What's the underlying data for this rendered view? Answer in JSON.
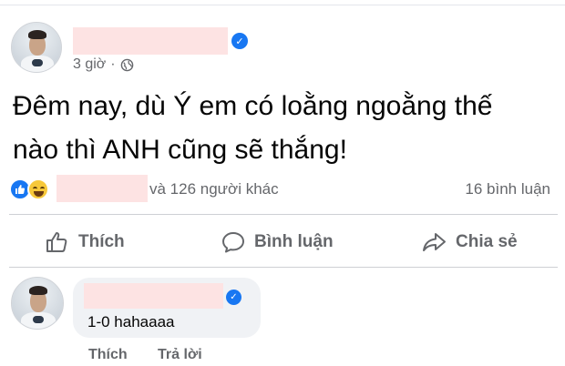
{
  "post": {
    "time": "3 giờ",
    "separator": "·",
    "text_line1": "Đêm nay, dù Ý em có loằng ngoằng thế",
    "text_line2": "nào thì ANH cũng sẽ thắng!",
    "reactions_others": "và 126 người khác",
    "comment_count": "16 bình luận"
  },
  "actions": {
    "like": "Thích",
    "comment": "Bình luận",
    "share": "Chia sẻ"
  },
  "comment": {
    "text": "1-0 hahaaaa",
    "like": "Thích",
    "reply": "Trả lời"
  },
  "colors": {
    "accent": "#1877f2",
    "secondary_text": "#65676b",
    "redaction": "#fde3e3",
    "bubble": "#f0f2f5"
  }
}
